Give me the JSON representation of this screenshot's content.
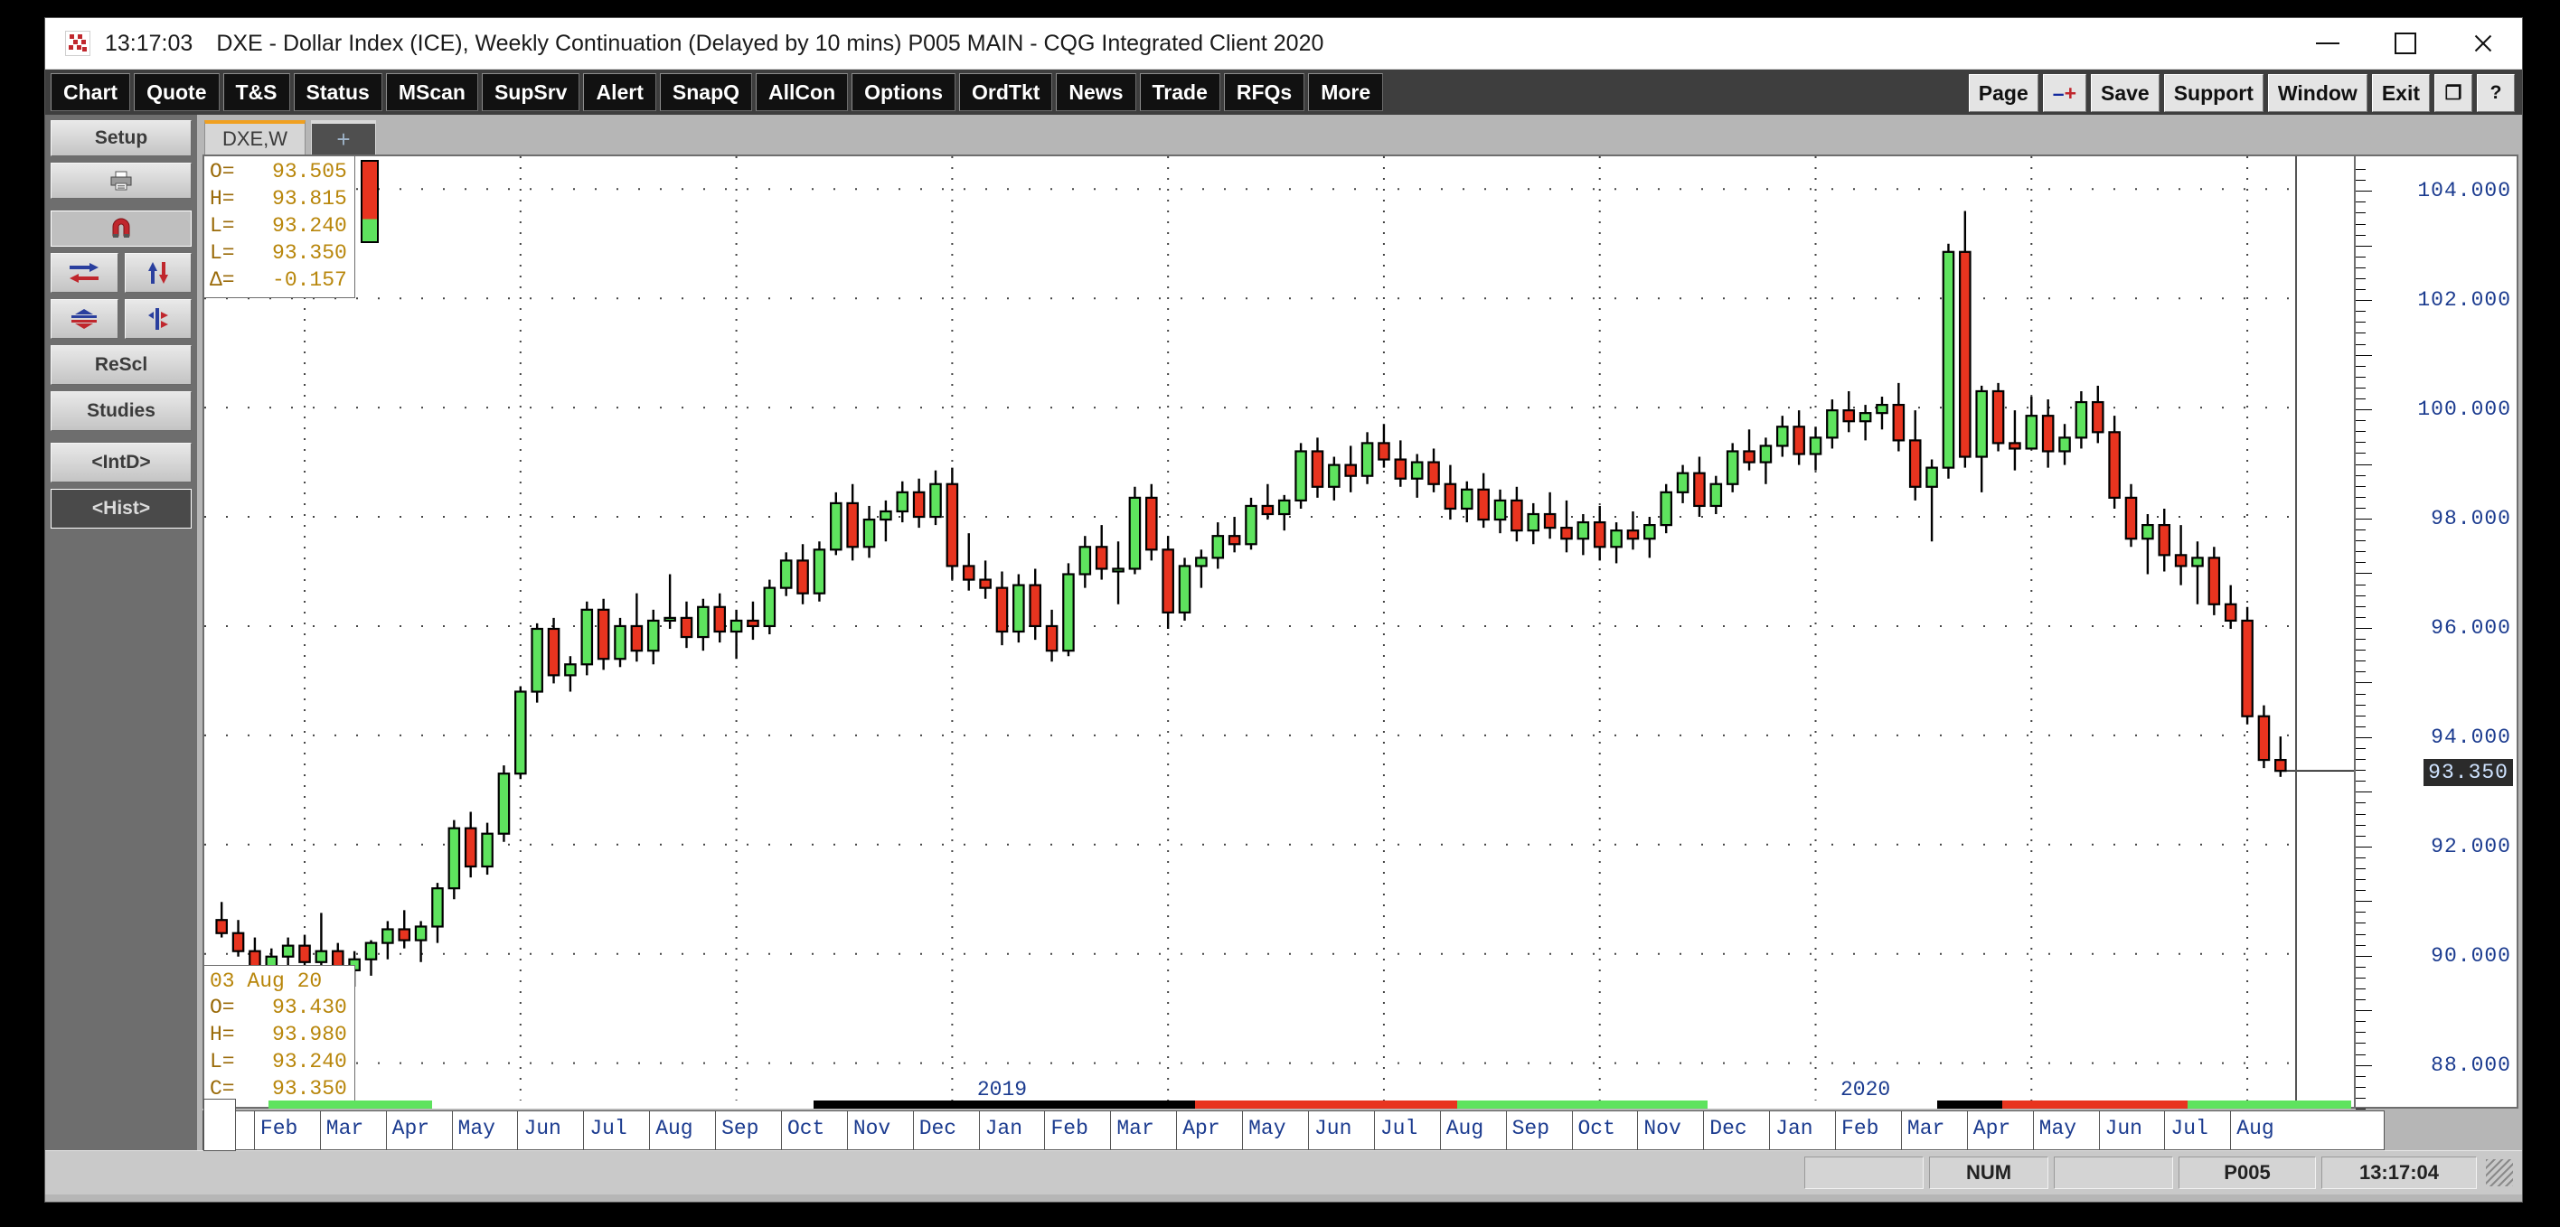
{
  "window": {
    "time": "13:17:03",
    "title": "DXE - Dollar Index (ICE), Weekly Continuation (Delayed by 10 mins)   P005 MAIN - CQG Integrated Client 2020",
    "minimize_label": "minimize",
    "maximize_label": "maximize",
    "close_label": "close"
  },
  "toolbar": {
    "buttons": [
      "Chart",
      "Quote",
      "T&S",
      "Status",
      "MScan",
      "SupSrv",
      "Alert",
      "SnapQ",
      "AllCon",
      "Options",
      "OrdTkt",
      "News",
      "Trade",
      "RFQs",
      "More"
    ],
    "right_buttons": [
      {
        "label": "Page",
        "type": "text"
      },
      {
        "label": "-+",
        "type": "minusplus"
      },
      {
        "label": "Save",
        "type": "text"
      },
      {
        "label": "Support",
        "type": "text"
      },
      {
        "label": "Window",
        "type": "text"
      },
      {
        "label": "Exit",
        "type": "text"
      },
      {
        "label": "❐",
        "type": "square"
      },
      {
        "label": "?",
        "type": "square"
      }
    ]
  },
  "sidebar": {
    "items": [
      {
        "label": "Setup",
        "icon": "setup-button",
        "kind": "text"
      },
      {
        "label": "",
        "icon": "printer-icon",
        "kind": "icon"
      },
      {
        "label": "",
        "icon": "magnet-icon",
        "kind": "icon",
        "selected": true
      },
      {
        "label": "",
        "icon": "arrows-horizontal-icon",
        "kind": "icon"
      },
      {
        "label": "",
        "icon": "arrows-vertical-icon",
        "kind": "icon"
      },
      {
        "label": "",
        "icon": "compress-vertical-icon",
        "kind": "icon"
      },
      {
        "label": "",
        "icon": "expand-split-icon",
        "kind": "icon"
      },
      {
        "label": "ReScl",
        "icon": "rescale-button",
        "kind": "text"
      },
      {
        "label": "Studies",
        "icon": "studies-button",
        "kind": "text"
      },
      {
        "label": "<IntD>",
        "icon": "intraday-button",
        "kind": "text"
      },
      {
        "label": "<Hist>",
        "icon": "history-button",
        "kind": "text",
        "active": true
      }
    ]
  },
  "tabs": {
    "items": [
      {
        "label": "DXE,W",
        "active": true
      }
    ],
    "add_label": "+"
  },
  "quote_top": {
    "rows": [
      {
        "key": "O=",
        "value": "93.505"
      },
      {
        "key": "H=",
        "value": "93.815"
      },
      {
        "key": "L=",
        "value": "93.240"
      },
      {
        "key": "L=",
        "value": "93.350"
      },
      {
        "key": "Δ=",
        "value": "-0.157"
      }
    ]
  },
  "quote_bottom": {
    "date": "03 Aug 20",
    "rows": [
      {
        "key": "O=",
        "value": "93.430"
      },
      {
        "key": "H=",
        "value": "93.980"
      },
      {
        "key": "L=",
        "value": "93.240"
      },
      {
        "key": "C=",
        "value": "93.350"
      }
    ]
  },
  "status": {
    "num": "NUM",
    "page": "P005",
    "time": "13:17:04"
  },
  "colors": {
    "up": "#5ee35e",
    "down": "#e8341f",
    "outline": "#000000",
    "grid": "#555555",
    "axis_text": "#1b3b8f",
    "quote_text": "#b8860b",
    "tab_accent": "#f0a020"
  },
  "chart_data": {
    "type": "candlestick",
    "title": "DXE - Dollar Index (ICE), Weekly Continuation",
    "xlabel": "",
    "ylabel": "",
    "ylim": [
      87.2,
      104.6
    ],
    "y_ticks": [
      104.0,
      102.0,
      100.0,
      98.0,
      96.0,
      94.0,
      92.0,
      90.0,
      88.0
    ],
    "y_tick_labels": [
      "104.000",
      "102.000",
      "100.000",
      "98.000",
      "96.000",
      "94.000",
      "92.000",
      "90.000",
      "88.000"
    ],
    "current_price": 93.35,
    "current_price_label": "93.350",
    "grid": true,
    "legend": "none",
    "x_tick_labels": [
      "Feb",
      "Mar",
      "Apr",
      "May",
      "Jun",
      "Jul",
      "Aug",
      "Sep",
      "Oct",
      "Nov",
      "Dec",
      "Jan",
      "Feb",
      "Mar",
      "Apr",
      "May",
      "Jun",
      "Jul",
      "Aug",
      "Sep",
      "Oct",
      "Nov",
      "Dec",
      "Jan",
      "Feb",
      "Mar",
      "Apr",
      "May",
      "Jun",
      "Jul",
      "Aug"
    ],
    "year_labels": [
      {
        "text": "2019",
        "index": 47
      },
      {
        "text": "2020",
        "index": 99
      }
    ],
    "ohlc": [
      [
        90.62,
        90.95,
        90.3,
        90.38
      ],
      [
        90.38,
        90.62,
        89.95,
        90.05
      ],
      [
        90.05,
        90.3,
        89.55,
        89.72
      ],
      [
        89.72,
        90.1,
        89.45,
        89.95
      ],
      [
        89.95,
        90.3,
        89.6,
        90.15
      ],
      [
        90.15,
        90.35,
        89.7,
        89.85
      ],
      [
        89.85,
        90.75,
        89.6,
        90.05
      ],
      [
        90.05,
        90.2,
        89.55,
        89.7
      ],
      [
        89.7,
        90.05,
        89.4,
        89.9
      ],
      [
        89.9,
        90.25,
        89.6,
        90.2
      ],
      [
        90.2,
        90.6,
        89.9,
        90.45
      ],
      [
        90.45,
        90.8,
        90.1,
        90.25
      ],
      [
        90.25,
        90.6,
        89.85,
        90.5
      ],
      [
        90.5,
        91.3,
        90.2,
        91.2
      ],
      [
        91.2,
        92.45,
        91.0,
        92.3
      ],
      [
        92.3,
        92.6,
        91.4,
        91.6
      ],
      [
        91.6,
        92.4,
        91.45,
        92.2
      ],
      [
        92.2,
        93.45,
        92.05,
        93.3
      ],
      [
        93.3,
        94.9,
        93.2,
        94.8
      ],
      [
        94.8,
        96.05,
        94.6,
        95.95
      ],
      [
        95.95,
        96.15,
        94.95,
        95.1
      ],
      [
        95.1,
        95.45,
        94.8,
        95.3
      ],
      [
        95.3,
        96.45,
        95.1,
        96.3
      ],
      [
        96.3,
        96.5,
        95.2,
        95.4
      ],
      [
        95.4,
        96.15,
        95.25,
        96.0
      ],
      [
        96.0,
        96.6,
        95.35,
        95.55
      ],
      [
        95.55,
        96.3,
        95.3,
        96.1
      ],
      [
        96.1,
        96.95,
        95.95,
        96.15
      ],
      [
        96.15,
        96.45,
        95.6,
        95.8
      ],
      [
        95.8,
        96.5,
        95.55,
        96.35
      ],
      [
        96.35,
        96.6,
        95.7,
        95.9
      ],
      [
        95.9,
        96.3,
        95.4,
        96.1
      ],
      [
        96.1,
        96.45,
        95.75,
        96.0
      ],
      [
        96.0,
        96.85,
        95.85,
        96.7
      ],
      [
        96.7,
        97.35,
        96.55,
        97.2
      ],
      [
        97.2,
        97.5,
        96.4,
        96.6
      ],
      [
        96.6,
        97.55,
        96.45,
        97.4
      ],
      [
        97.4,
        98.45,
        97.3,
        98.25
      ],
      [
        98.25,
        98.6,
        97.2,
        97.45
      ],
      [
        97.45,
        98.2,
        97.25,
        97.95
      ],
      [
        97.95,
        98.3,
        97.55,
        98.1
      ],
      [
        98.1,
        98.65,
        97.9,
        98.45
      ],
      [
        98.45,
        98.7,
        97.8,
        98.0
      ],
      [
        98.0,
        98.85,
        97.85,
        98.6
      ],
      [
        98.6,
        98.9,
        96.85,
        97.1
      ],
      [
        97.1,
        97.7,
        96.65,
        96.85
      ],
      [
        96.85,
        97.2,
        96.5,
        96.7
      ],
      [
        96.7,
        97.0,
        95.65,
        95.9
      ],
      [
        95.9,
        96.95,
        95.7,
        96.75
      ],
      [
        96.75,
        97.05,
        95.75,
        96.0
      ],
      [
        96.0,
        96.3,
        95.35,
        95.55
      ],
      [
        95.55,
        97.15,
        95.45,
        96.95
      ],
      [
        96.95,
        97.65,
        96.7,
        97.45
      ],
      [
        97.45,
        97.85,
        96.85,
        97.05
      ],
      [
        97.05,
        97.55,
        96.4,
        97.05
      ],
      [
        97.05,
        98.55,
        96.95,
        98.35
      ],
      [
        98.35,
        98.6,
        97.2,
        97.4
      ],
      [
        97.4,
        97.65,
        95.95,
        96.25
      ],
      [
        96.25,
        97.25,
        96.1,
        97.1
      ],
      [
        97.1,
        97.4,
        96.7,
        97.25
      ],
      [
        97.25,
        97.9,
        97.05,
        97.65
      ],
      [
        97.65,
        98.0,
        97.35,
        97.5
      ],
      [
        97.5,
        98.35,
        97.4,
        98.2
      ],
      [
        98.2,
        98.6,
        97.95,
        98.05
      ],
      [
        98.05,
        98.4,
        97.75,
        98.3
      ],
      [
        98.3,
        99.35,
        98.15,
        99.2
      ],
      [
        99.2,
        99.45,
        98.35,
        98.55
      ],
      [
        98.55,
        99.1,
        98.3,
        98.95
      ],
      [
        98.95,
        99.3,
        98.45,
        98.75
      ],
      [
        98.75,
        99.55,
        98.6,
        99.35
      ],
      [
        99.35,
        99.7,
        98.9,
        99.05
      ],
      [
        99.05,
        99.4,
        98.55,
        98.7
      ],
      [
        98.7,
        99.15,
        98.35,
        99.0
      ],
      [
        99.0,
        99.25,
        98.45,
        98.6
      ],
      [
        98.6,
        98.95,
        97.95,
        98.15
      ],
      [
        98.15,
        98.65,
        97.9,
        98.5
      ],
      [
        98.5,
        98.8,
        97.8,
        97.95
      ],
      [
        97.95,
        98.5,
        97.7,
        98.3
      ],
      [
        98.3,
        98.55,
        97.55,
        97.75
      ],
      [
        97.75,
        98.25,
        97.5,
        98.05
      ],
      [
        98.05,
        98.45,
        97.6,
        97.8
      ],
      [
        97.8,
        98.3,
        97.35,
        97.6
      ],
      [
        97.6,
        98.05,
        97.3,
        97.9
      ],
      [
        97.9,
        98.2,
        97.2,
        97.45
      ],
      [
        97.45,
        97.9,
        97.15,
        97.75
      ],
      [
        97.75,
        98.1,
        97.4,
        97.6
      ],
      [
        97.6,
        98.0,
        97.25,
        97.85
      ],
      [
        97.85,
        98.6,
        97.7,
        98.45
      ],
      [
        98.45,
        98.95,
        98.25,
        98.8
      ],
      [
        98.8,
        99.1,
        98.0,
        98.2
      ],
      [
        98.2,
        98.75,
        98.05,
        98.6
      ],
      [
        98.6,
        99.35,
        98.45,
        99.2
      ],
      [
        99.2,
        99.6,
        98.85,
        99.0
      ],
      [
        99.0,
        99.45,
        98.6,
        99.3
      ],
      [
        99.3,
        99.85,
        99.1,
        99.65
      ],
      [
        99.65,
        99.95,
        98.95,
        99.15
      ],
      [
        99.15,
        99.65,
        98.85,
        99.45
      ],
      [
        99.45,
        100.15,
        99.25,
        99.95
      ],
      [
        99.95,
        100.3,
        99.55,
        99.75
      ],
      [
        99.75,
        100.05,
        99.4,
        99.9
      ],
      [
        99.9,
        100.2,
        99.6,
        100.05
      ],
      [
        100.05,
        100.45,
        99.2,
        99.4
      ],
      [
        99.4,
        99.95,
        98.3,
        98.55
      ],
      [
        98.55,
        99.05,
        97.55,
        98.9
      ],
      [
        98.9,
        103.0,
        98.7,
        102.85
      ],
      [
        102.85,
        103.6,
        98.9,
        99.1
      ],
      [
        99.1,
        100.4,
        98.45,
        100.3
      ],
      [
        100.3,
        100.45,
        99.2,
        99.35
      ],
      [
        99.35,
        99.95,
        98.85,
        99.25
      ],
      [
        99.25,
        100.2,
        99.35,
        99.85
      ],
      [
        99.85,
        100.15,
        98.9,
        99.2
      ],
      [
        99.2,
        99.7,
        98.95,
        99.45
      ],
      [
        99.45,
        100.3,
        99.25,
        100.1
      ],
      [
        100.1,
        100.4,
        99.35,
        99.55
      ],
      [
        99.55,
        99.85,
        98.15,
        98.35
      ],
      [
        98.35,
        98.6,
        97.45,
        97.6
      ],
      [
        97.6,
        98.05,
        96.95,
        97.85
      ],
      [
        97.85,
        98.15,
        97.0,
        97.3
      ],
      [
        97.3,
        97.85,
        96.75,
        97.1
      ],
      [
        97.1,
        97.55,
        96.4,
        97.25
      ],
      [
        97.25,
        97.45,
        96.2,
        96.4
      ],
      [
        96.4,
        96.75,
        95.95,
        96.1
      ],
      [
        96.1,
        96.35,
        94.2,
        94.35
      ],
      [
        94.35,
        94.55,
        93.4,
        93.55
      ],
      [
        93.55,
        93.98,
        93.24,
        93.35
      ]
    ]
  }
}
